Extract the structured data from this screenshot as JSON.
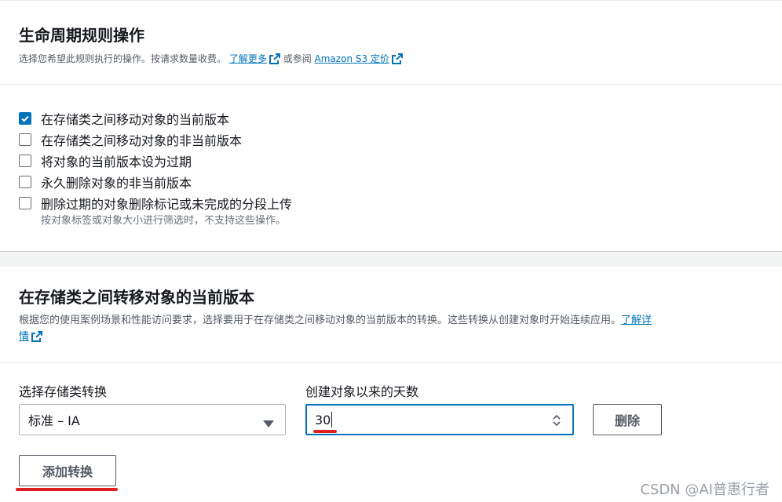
{
  "lifecycle": {
    "title": "生命周期规则操作",
    "desc_prefix": "选择您希望此规则执行的操作。按请求数量收费。",
    "learn_more": "了解更多",
    "or_see": "或参阅",
    "pricing_link": "Amazon S3 定价",
    "options": [
      {
        "label": "在存储类之间移动对象的当前版本",
        "checked": true
      },
      {
        "label": "在存储类之间移动对象的非当前版本",
        "checked": false
      },
      {
        "label": "将对象的当前版本设为过期",
        "checked": false
      },
      {
        "label": "永久删除对象的非当前版本",
        "checked": false
      },
      {
        "label": "删除过期的对象删除标记或未完成的分段上传",
        "checked": false
      }
    ],
    "hint": "按对象标签或对象大小进行筛选时，不支持这些操作。"
  },
  "transition": {
    "title": "在存储类之间转移对象的当前版本",
    "desc": "根据您的使用案例场景和性能访问要求，选择要用于在存储类之间移动对象的当前版本的转换。这些转换从创建对象时开始连续应用。",
    "learn_more_part1": "了解详",
    "learn_more_part2": "情",
    "storage_class_label": "选择存储类转换",
    "storage_class_value": "标准 – IA",
    "days_label": "创建对象以来的天数",
    "days_value": "30",
    "delete_button": "删除",
    "add_button": "添加转换"
  },
  "watermark": "CSDN @AI普惠行者",
  "colors": {
    "accent": "#0073bb",
    "annotation": "#e02020"
  },
  "icons": [
    "external-link-icon",
    "checkmark-icon",
    "caret-down-icon",
    "spinner-icon"
  ]
}
